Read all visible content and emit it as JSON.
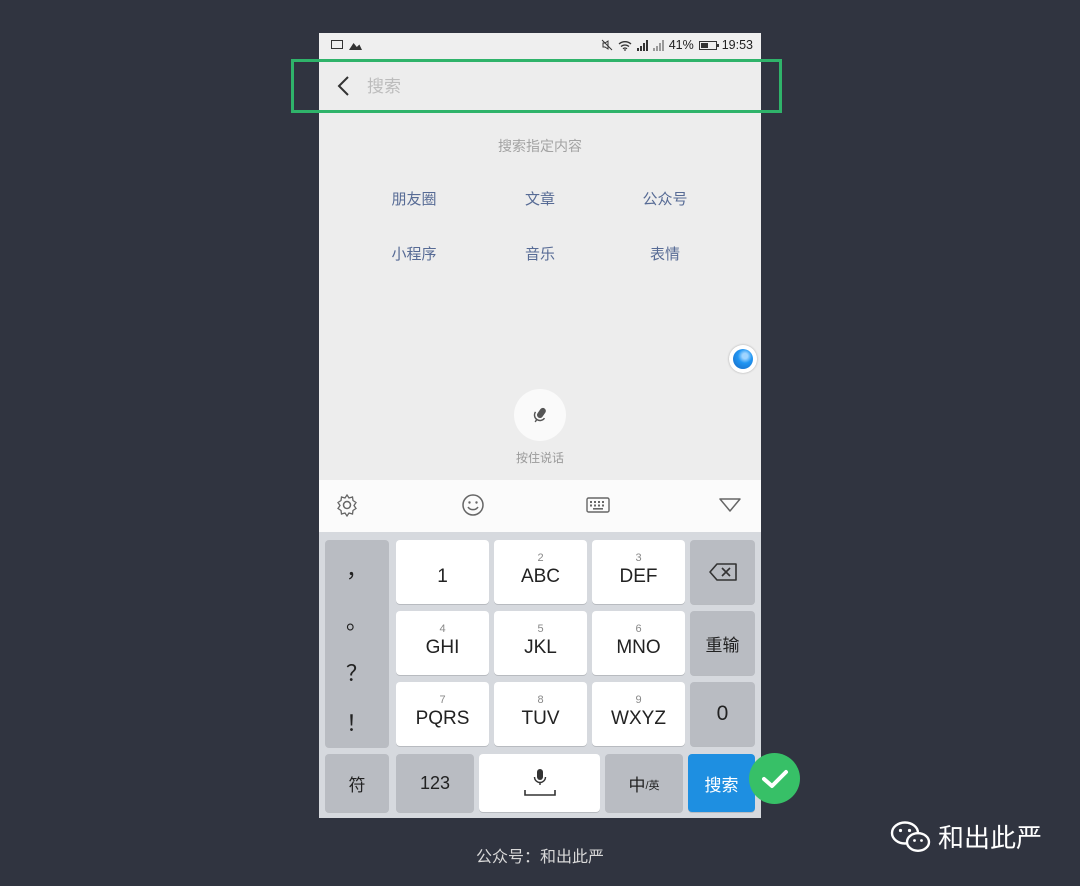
{
  "status_bar": {
    "battery": "41%",
    "time": "19:53"
  },
  "search": {
    "placeholder": "搜索",
    "value": ""
  },
  "search_hint": "搜索指定内容",
  "categories": [
    "朋友圈",
    "文章",
    "公众号",
    "小程序",
    "音乐",
    "表情"
  ],
  "voice": {
    "label": "按住说话"
  },
  "keyboard": {
    "punct": [
      "，",
      "。",
      "？",
      "！"
    ],
    "keys": [
      {
        "num": "",
        "label": "1"
      },
      {
        "num": "2",
        "label": "ABC"
      },
      {
        "num": "3",
        "label": "DEF"
      },
      {
        "num": "4",
        "label": "GHI"
      },
      {
        "num": "5",
        "label": "JKL"
      },
      {
        "num": "6",
        "label": "MNO"
      },
      {
        "num": "7",
        "label": "PQRS"
      },
      {
        "num": "8",
        "label": "TUV"
      },
      {
        "num": "9",
        "label": "WXYZ"
      }
    ],
    "reinput": "重输",
    "zero": "0",
    "symbol": "符",
    "numeric": "123",
    "lang_main": "中",
    "lang_sub": "/英",
    "search_key": "搜索"
  },
  "caption": "公众号：和出此严",
  "watermark": "和出此严",
  "colors": {
    "highlight": "#2fb36a",
    "link": "#576b95",
    "search_key": "#1e8fe1",
    "confirm": "#37c067"
  }
}
